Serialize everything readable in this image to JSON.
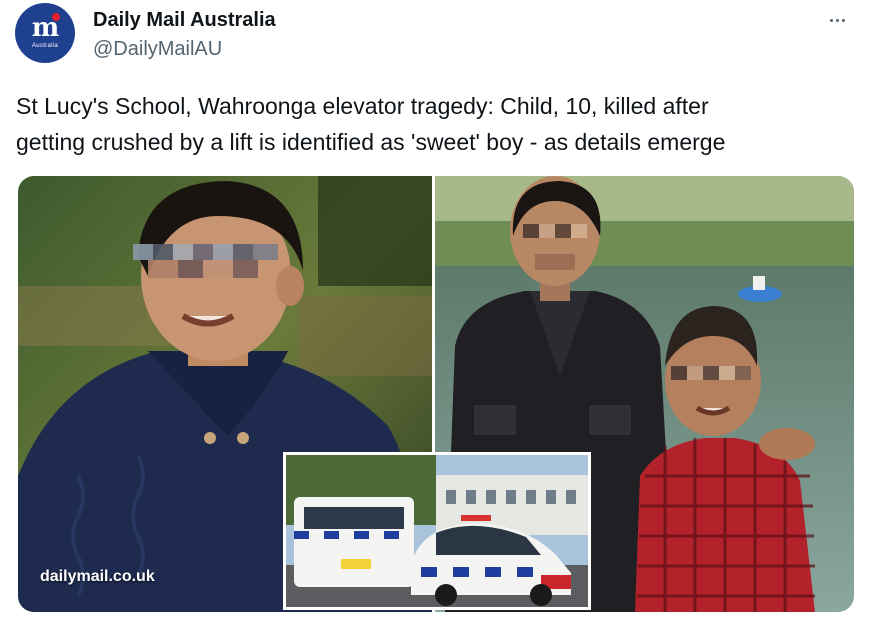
{
  "author": {
    "display_name": "Daily Mail Australia",
    "handle": "@DailyMailAU",
    "avatar_label": "Australia"
  },
  "tweet": {
    "text_line1": "St Lucy's School, Wahroonga elevator tragedy: Child, 10, killed after",
    "text_line2": "getting crushed by a lift is identified as 'sweet' boy - as details emerge"
  },
  "media": {
    "watermark": "dailymail.co.uk",
    "left_photo": "boy-in-navy-sweater",
    "right_photo": "woman-and-boy-by-river",
    "inset_photo": "police-car-and-van"
  },
  "icons": {
    "more": "more-horizontal-icon"
  },
  "colors": {
    "brand_blue": "#1f3f8f",
    "text_primary": "#0f1419",
    "text_secondary": "#536471"
  }
}
